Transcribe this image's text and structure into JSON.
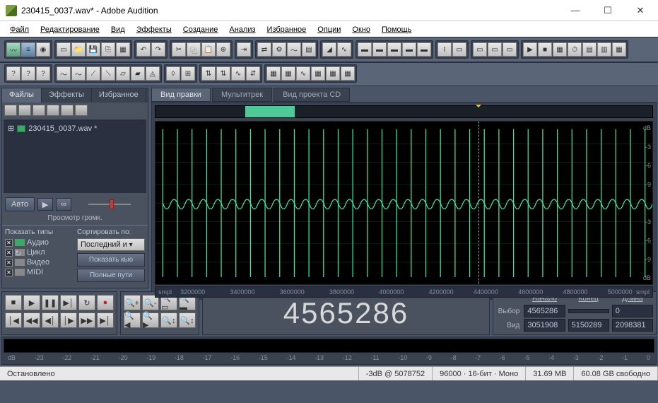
{
  "title": "230415_0037.wav* - Adobe Audition",
  "menu": [
    "Файл",
    "Редактирование",
    "Вид",
    "Эффекты",
    "Создание",
    "Анализ",
    "Избранное",
    "Опции",
    "Окно",
    "Помощь"
  ],
  "leftPanel": {
    "tabs": [
      "Файлы",
      "Эффекты",
      "Избранное"
    ],
    "fileName": "230415_0037.wav *",
    "autoBtn": "Авто",
    "volLabel": "Просмотр громк.",
    "showTypesLabel": "Показать типы",
    "sortByLabel": "Сортировать по:",
    "types": [
      "Аудио",
      "Цикл",
      "Видео",
      "MIDI"
    ],
    "sortValue": "Последний и",
    "showCueBtn": "Показать кью",
    "fullPathsBtn": "Полные пути"
  },
  "wfTabs": [
    "Вид правки",
    "Мультитрек",
    "Вид проекта CD"
  ],
  "dbScale": [
    "dB",
    "-3",
    "-6",
    "-9",
    "-3",
    "-6",
    "-9",
    "dB"
  ],
  "ruler": {
    "unit": "smpl",
    "ticks": [
      "3200000",
      "3400000",
      "3600000",
      "3800000",
      "4000000",
      "4200000",
      "4400000",
      "4600000",
      "4800000",
      "5000000"
    ]
  },
  "timeDisplay": "4565286",
  "selection": {
    "headers": [
      "Начало",
      "Конец",
      "Длина"
    ],
    "rows": [
      {
        "label": "Выбор",
        "vals": [
          "4565286",
          "",
          "0"
        ]
      },
      {
        "label": "Вид",
        "vals": [
          "3051908",
          "5150289",
          "2098381"
        ]
      }
    ]
  },
  "levelScale": [
    "dB",
    "-23",
    "-22",
    "-21",
    "-20",
    "-19",
    "-18",
    "-17",
    "-16",
    "-15",
    "-14",
    "-13",
    "-12",
    "-11",
    "-10",
    "-9",
    "-8",
    "-7",
    "-6",
    "-5",
    "-4",
    "-3",
    "-2",
    "-1",
    "0"
  ],
  "status": {
    "state": "Остановлено",
    "peak": "-3dB @ 5078752",
    "format": "96000 · 16-бит · Моно",
    "size": "31.69 MB",
    "disk": "60.08 GB свободно"
  }
}
